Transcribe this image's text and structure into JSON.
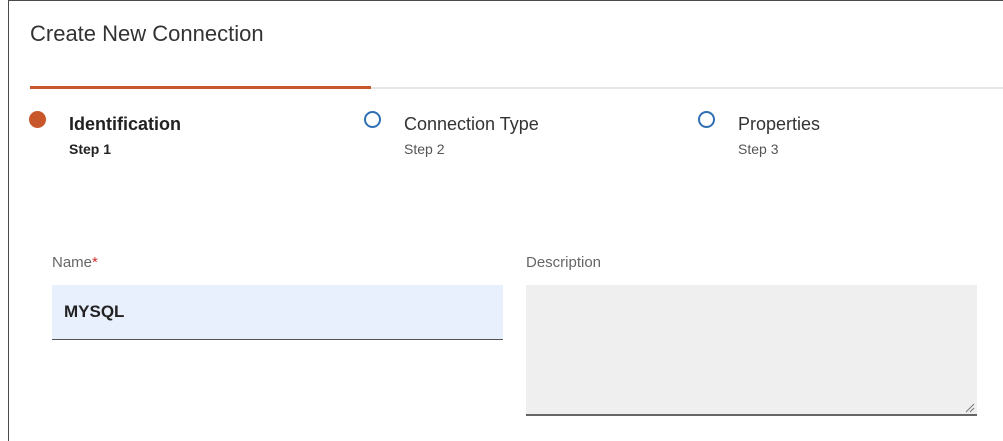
{
  "dialog": {
    "title": "Create New Connection",
    "progress_fraction": 0.35
  },
  "steps": [
    {
      "label": "Identification",
      "sub": "Step 1",
      "state": "active"
    },
    {
      "label": "Connection Type",
      "sub": "Step 2",
      "state": "pending"
    },
    {
      "label": "Properties",
      "sub": "Step 3",
      "state": "pending"
    }
  ],
  "form": {
    "name_label": "Name",
    "required_marker": "*",
    "name_value": "MYSQL",
    "description_label": "Description",
    "description_value": ""
  },
  "colors": {
    "accent": "#c8582b",
    "step_pending": "#2f6fb3",
    "required": "#d32f2f",
    "input_active_bg": "#e8f0fe"
  },
  "icons": {
    "step_active": "filled-circle",
    "step_pending": "hollow-circle",
    "resize": "resize-handle-icon"
  }
}
